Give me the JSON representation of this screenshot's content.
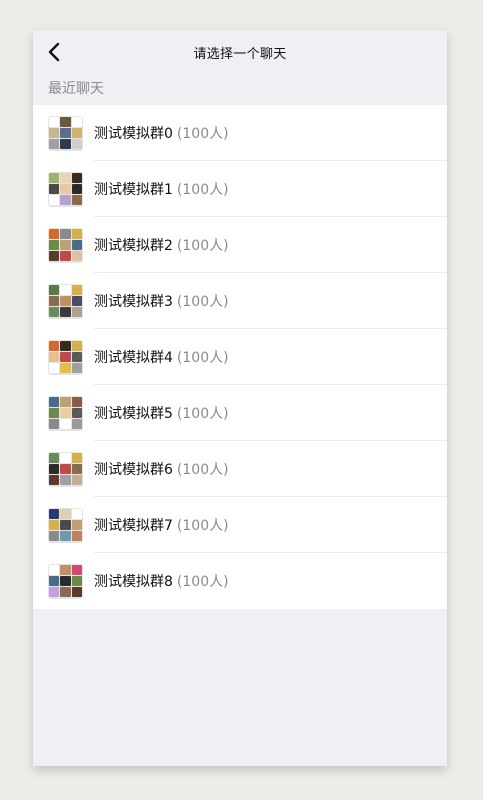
{
  "nav": {
    "back_icon": "chevron-left-icon",
    "title": "请选择一个聊天"
  },
  "section": {
    "title": "最近聊天"
  },
  "chats": [
    {
      "name": "测试模拟群0",
      "count": "(100人)",
      "avatar_colors": [
        "#ffffff",
        "#6b5a3e",
        "#ffffff",
        "#c9b78f",
        "#5a6e8c",
        "#d3b26a",
        "#a0a0a0",
        "#2e3b4f",
        "#cfcfcf"
      ]
    },
    {
      "name": "测试模拟群1",
      "count": "(100人)",
      "avatar_colors": [
        "#9fb36a",
        "#e8d6b0",
        "#3a2a1e",
        "#4a4a4a",
        "#f0c8a0",
        "#2b2b2b",
        "#ffffff",
        "#b8a0d0",
        "#8a6a4a"
      ]
    },
    {
      "name": "测试模拟群2",
      "count": "(100人)",
      "avatar_colors": [
        "#d46a2a",
        "#8a8a8a",
        "#d8b04a",
        "#6a8a4a",
        "#c0a070",
        "#4a6a8a",
        "#5a3a2a",
        "#c04a4a",
        "#e0c0a0"
      ]
    },
    {
      "name": "测试模拟群3",
      "count": "(100人)",
      "avatar_colors": [
        "#5a7a4a",
        "#ffffff",
        "#d8b04a",
        "#8a6a4a",
        "#c09060",
        "#4a4a6a",
        "#6a8a5a",
        "#3a3a3a",
        "#b0a090"
      ]
    },
    {
      "name": "测试模拟群4",
      "count": "(100人)",
      "avatar_colors": [
        "#d46a2a",
        "#3a2a1e",
        "#d8b04a",
        "#e8c090",
        "#c04a4a",
        "#5a5a5a",
        "#ffffff",
        "#e0c040",
        "#a0a0a0"
      ]
    },
    {
      "name": "测试模拟群5",
      "count": "(100人)",
      "avatar_colors": [
        "#4a6a8a",
        "#c0a070",
        "#8a5a4a",
        "#6a8a4a",
        "#e8d0a0",
        "#5a5a5a",
        "#8a8a8a",
        "#ffffff",
        "#9a9a9a"
      ]
    },
    {
      "name": "测试模拟群6",
      "count": "(100人)",
      "avatar_colors": [
        "#6a8a5a",
        "#ffffff",
        "#d8b04a",
        "#2b2b2b",
        "#c04a4a",
        "#8a6a4a",
        "#5a3a2a",
        "#a0a0a0",
        "#c0b090"
      ]
    },
    {
      "name": "测试模拟群7",
      "count": "(100人)",
      "avatar_colors": [
        "#2a3a6a",
        "#e0d0b0",
        "#ffffff",
        "#d8b04a",
        "#4a4a4a",
        "#c0a070",
        "#8a8a8a",
        "#6a9ab0",
        "#c08060"
      ]
    },
    {
      "name": "测试模拟群8",
      "count": "(100人)",
      "avatar_colors": [
        "#ffffff",
        "#c09060",
        "#d04a6a",
        "#4a6a8a",
        "#2b2b2b",
        "#6a8a4a",
        "#c0a0e0",
        "#8a6a4a",
        "#5a3a2a"
      ]
    }
  ]
}
